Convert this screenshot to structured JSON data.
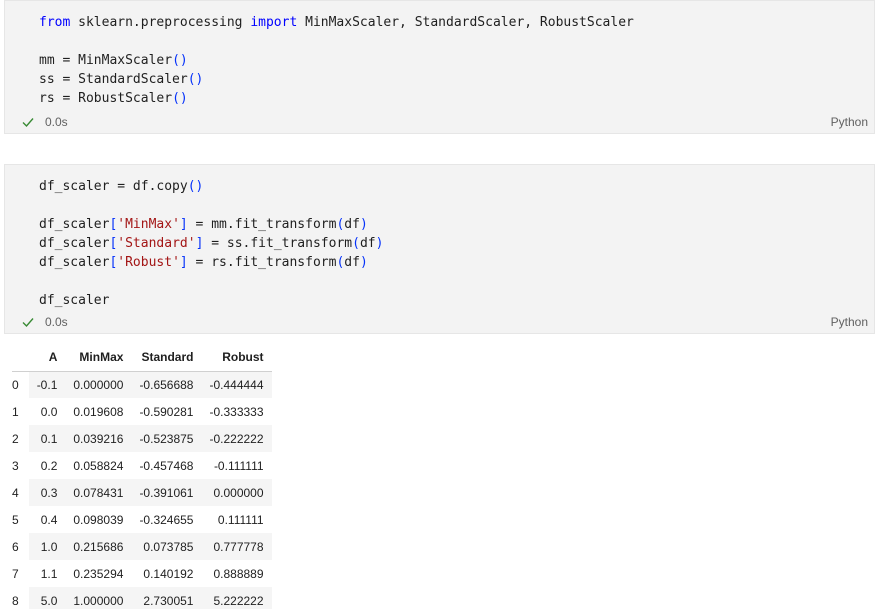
{
  "cells": [
    {
      "lines": [
        [
          {
            "t": "from",
            "c": "kw"
          },
          {
            "t": " sklearn.preprocessing ",
            "c": ""
          },
          {
            "t": "import",
            "c": "kw"
          },
          {
            "t": " MinMaxScaler, StandardScaler, RobustScaler",
            "c": ""
          }
        ],
        [],
        [
          {
            "t": "mm = ",
            "c": ""
          },
          {
            "t": "MinMaxScaler",
            "c": ""
          },
          {
            "t": "()",
            "c": "paren"
          }
        ],
        [
          {
            "t": "ss = ",
            "c": ""
          },
          {
            "t": "StandardScaler",
            "c": ""
          },
          {
            "t": "()",
            "c": "paren"
          }
        ],
        [
          {
            "t": "rs = ",
            "c": ""
          },
          {
            "t": "RobustScaler",
            "c": ""
          },
          {
            "t": "()",
            "c": "paren"
          }
        ]
      ],
      "time": "0.0s",
      "language": "Python"
    },
    {
      "lines": [
        [
          {
            "t": "df_scaler = df.copy",
            "c": ""
          },
          {
            "t": "()",
            "c": "paren"
          }
        ],
        [],
        [
          {
            "t": "df_scaler",
            "c": ""
          },
          {
            "t": "[",
            "c": "paren"
          },
          {
            "t": "'MinMax'",
            "c": "str"
          },
          {
            "t": "]",
            "c": "paren"
          },
          {
            "t": " = mm.fit_transform",
            "c": ""
          },
          {
            "t": "(",
            "c": "paren"
          },
          {
            "t": "df",
            "c": ""
          },
          {
            "t": ")",
            "c": "paren"
          }
        ],
        [
          {
            "t": "df_scaler",
            "c": ""
          },
          {
            "t": "[",
            "c": "paren"
          },
          {
            "t": "'Standard'",
            "c": "str"
          },
          {
            "t": "]",
            "c": "paren"
          },
          {
            "t": " = ss.fit_transform",
            "c": ""
          },
          {
            "t": "(",
            "c": "paren"
          },
          {
            "t": "df",
            "c": ""
          },
          {
            "t": ")",
            "c": "paren"
          }
        ],
        [
          {
            "t": "df_scaler",
            "c": ""
          },
          {
            "t": "[",
            "c": "paren"
          },
          {
            "t": "'Robust'",
            "c": "str"
          },
          {
            "t": "]",
            "c": "paren"
          },
          {
            "t": " = rs.fit_transform",
            "c": ""
          },
          {
            "t": "(",
            "c": "paren"
          },
          {
            "t": "df",
            "c": ""
          },
          {
            "t": ")",
            "c": "paren"
          }
        ],
        [],
        [
          {
            "t": "df_scaler",
            "c": ""
          }
        ]
      ],
      "time": "0.0s",
      "language": "Python"
    }
  ],
  "output_table": {
    "columns": [
      "A",
      "MinMax",
      "Standard",
      "Robust"
    ],
    "rows": [
      {
        "index": "0",
        "values": [
          "-0.1",
          "0.000000",
          "-0.656688",
          "-0.444444"
        ]
      },
      {
        "index": "1",
        "values": [
          "0.0",
          "0.019608",
          "-0.590281",
          "-0.333333"
        ]
      },
      {
        "index": "2",
        "values": [
          "0.1",
          "0.039216",
          "-0.523875",
          "-0.222222"
        ]
      },
      {
        "index": "3",
        "values": [
          "0.2",
          "0.058824",
          "-0.457468",
          "-0.111111"
        ]
      },
      {
        "index": "4",
        "values": [
          "0.3",
          "0.078431",
          "-0.391061",
          "0.000000"
        ]
      },
      {
        "index": "5",
        "values": [
          "0.4",
          "0.098039",
          "-0.324655",
          "0.111111"
        ]
      },
      {
        "index": "6",
        "values": [
          "1.0",
          "0.215686",
          "0.073785",
          "0.777778"
        ]
      },
      {
        "index": "7",
        "values": [
          "1.1",
          "0.235294",
          "0.140192",
          "0.888889"
        ]
      },
      {
        "index": "8",
        "values": [
          "5.0",
          "1.000000",
          "2.730051",
          "5.222222"
        ]
      }
    ]
  },
  "icons": {
    "status_icon": "check-icon"
  },
  "colors": {
    "check": "#388a34",
    "cell_bg": "#f3f3f3"
  }
}
